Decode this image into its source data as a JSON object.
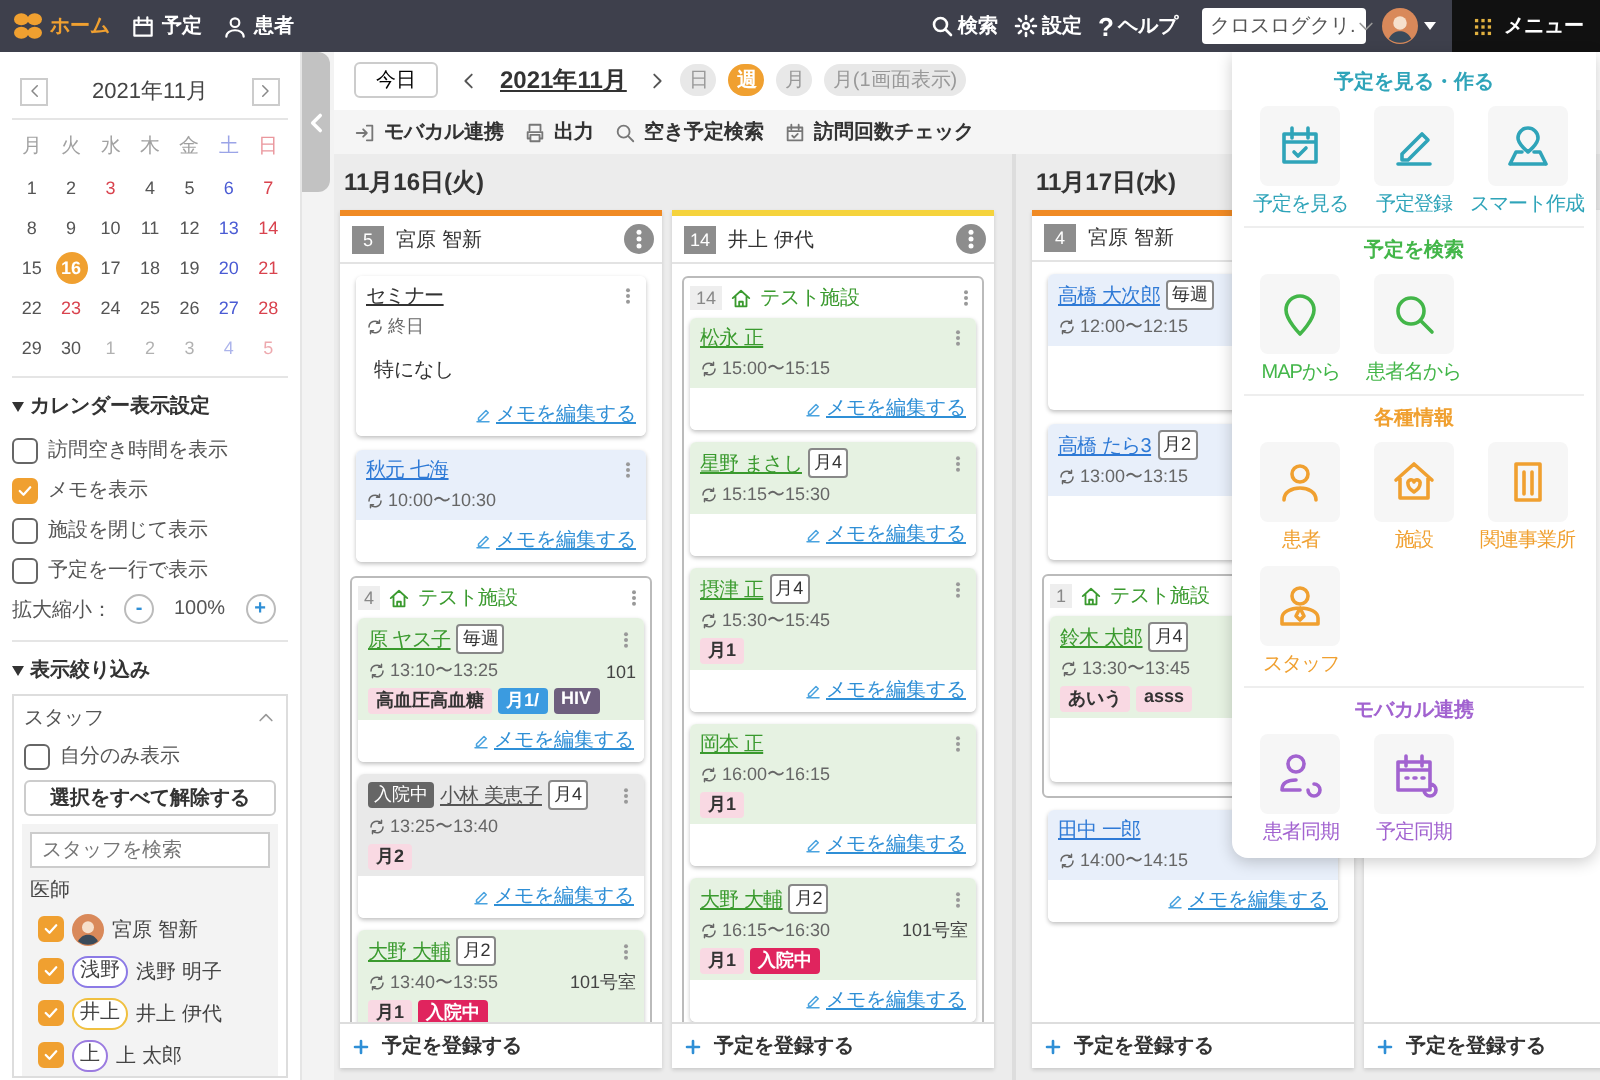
{
  "topbar": {
    "nav": [
      {
        "label": "ホーム",
        "kind": "logo",
        "selected": true
      },
      {
        "label": "予定",
        "kind": "calendar",
        "selected": false
      },
      {
        "label": "患者",
        "kind": "person",
        "selected": false
      }
    ],
    "tools": [
      {
        "label": "検索",
        "kind": "search"
      },
      {
        "label": "設定",
        "kind": "settings"
      },
      {
        "label": "ヘルプ",
        "kind": "help",
        "glyph": "?"
      }
    ],
    "clinic_select": "クロスログクリ.",
    "menu_label": "メニュー"
  },
  "calendar": {
    "title": "2021年11月",
    "weekdays": [
      {
        "label": "月",
        "kind": "normal"
      },
      {
        "label": "火",
        "kind": "normal"
      },
      {
        "label": "水",
        "kind": "normal"
      },
      {
        "label": "木",
        "kind": "normal"
      },
      {
        "label": "金",
        "kind": "normal"
      },
      {
        "label": "土",
        "kind": "saturday"
      },
      {
        "label": "日",
        "kind": "holiday"
      }
    ],
    "weeks": [
      [
        {
          "day": "1",
          "kind": "normal",
          "muted": false,
          "selected": false
        },
        {
          "day": "2",
          "kind": "normal",
          "muted": false,
          "selected": false
        },
        {
          "day": "3",
          "kind": "holiday",
          "muted": false,
          "selected": false
        },
        {
          "day": "4",
          "kind": "normal",
          "muted": false,
          "selected": false
        },
        {
          "day": "5",
          "kind": "normal",
          "muted": false,
          "selected": false
        },
        {
          "day": "6",
          "kind": "saturday",
          "muted": false,
          "selected": false
        },
        {
          "day": "7",
          "kind": "holiday",
          "muted": false,
          "selected": false
        }
      ],
      [
        {
          "day": "8",
          "kind": "normal",
          "muted": false,
          "selected": false
        },
        {
          "day": "9",
          "kind": "normal",
          "muted": false,
          "selected": false
        },
        {
          "day": "10",
          "kind": "normal",
          "muted": false,
          "selected": false
        },
        {
          "day": "11",
          "kind": "normal",
          "muted": false,
          "selected": false
        },
        {
          "day": "12",
          "kind": "normal",
          "muted": false,
          "selected": false
        },
        {
          "day": "13",
          "kind": "saturday",
          "muted": false,
          "selected": false
        },
        {
          "day": "14",
          "kind": "holiday",
          "muted": false,
          "selected": false
        }
      ],
      [
        {
          "day": "15",
          "kind": "normal",
          "muted": false,
          "selected": false
        },
        {
          "day": "16",
          "kind": "normal",
          "muted": false,
          "selected": true
        },
        {
          "day": "17",
          "kind": "normal",
          "muted": false,
          "selected": false
        },
        {
          "day": "18",
          "kind": "normal",
          "muted": false,
          "selected": false
        },
        {
          "day": "19",
          "kind": "normal",
          "muted": false,
          "selected": false
        },
        {
          "day": "20",
          "kind": "saturday",
          "muted": false,
          "selected": false
        },
        {
          "day": "21",
          "kind": "holiday",
          "muted": false,
          "selected": false
        }
      ],
      [
        {
          "day": "22",
          "kind": "normal",
          "muted": false,
          "selected": false
        },
        {
          "day": "23",
          "kind": "holiday",
          "muted": false,
          "selected": false
        },
        {
          "day": "24",
          "kind": "normal",
          "muted": false,
          "selected": false
        },
        {
          "day": "25",
          "kind": "normal",
          "muted": false,
          "selected": false
        },
        {
          "day": "26",
          "kind": "normal",
          "muted": false,
          "selected": false
        },
        {
          "day": "27",
          "kind": "saturday",
          "muted": false,
          "selected": false
        },
        {
          "day": "28",
          "kind": "holiday",
          "muted": false,
          "selected": false
        }
      ],
      [
        {
          "day": "29",
          "kind": "normal",
          "muted": false,
          "selected": false
        },
        {
          "day": "30",
          "kind": "normal",
          "muted": false,
          "selected": false
        },
        {
          "day": "1",
          "kind": "normal",
          "muted": true,
          "selected": false
        },
        {
          "day": "2",
          "kind": "normal",
          "muted": true,
          "selected": false
        },
        {
          "day": "3",
          "kind": "normal",
          "muted": true,
          "selected": false
        },
        {
          "day": "4",
          "kind": "saturday",
          "muted": true,
          "selected": false
        },
        {
          "day": "5",
          "kind": "holiday",
          "muted": true,
          "selected": false
        }
      ]
    ]
  },
  "display_settings": {
    "title": "カレンダー表示設定",
    "options": [
      {
        "label": "訪問空き時間を表示",
        "checked": false
      },
      {
        "label": "メモを表示",
        "checked": true
      },
      {
        "label": "施設を閉じて表示",
        "checked": false
      },
      {
        "label": "予定を一行で表示",
        "checked": false
      }
    ],
    "zoom_label": "拡大縮小：",
    "zoom_minus": "-",
    "zoom_value": "100%",
    "zoom_plus": "+"
  },
  "filter": {
    "title": "表示絞り込み",
    "panel_title": "スタッフ",
    "self_only": {
      "label": "自分のみ表示",
      "checked": false
    },
    "clear_button": "選択をすべて解除する",
    "search_placeholder": "スタッフを検索",
    "group": "医師",
    "staff": [
      {
        "name": "宮原 智新",
        "kind": "photo",
        "checked": true
      },
      {
        "name": "浅野 明子",
        "kind": "initials",
        "initials": "浅野",
        "color": "#8c7ae6",
        "checked": true
      },
      {
        "name": "井上 伊代",
        "kind": "initials",
        "initials": "井上",
        "color": "#f0c040",
        "checked": true
      },
      {
        "name": "上 太郎",
        "kind": "initials",
        "initials": "上",
        "color": "#9b7be0",
        "checked": true
      }
    ]
  },
  "toolbar": {
    "today": "今日",
    "month": "2021年11月",
    "views": [
      {
        "label": "日",
        "selected": false
      },
      {
        "label": "週",
        "selected": true
      },
      {
        "label": "月",
        "selected": false
      },
      {
        "label": "月(1画面表示)",
        "selected": false
      }
    ],
    "actions": [
      {
        "label": "モバカル連携",
        "kind": "sync-in"
      },
      {
        "label": "出力",
        "kind": "print"
      },
      {
        "label": "空き予定検索",
        "kind": "search"
      },
      {
        "label": "訪問回数チェック",
        "kind": "calendar-check"
      }
    ]
  },
  "days": [
    {
      "date": "11月16日(火)",
      "columns": [
        {
          "count": "5",
          "staff": "宮原 智新",
          "color": "#f08a24",
          "more_buttons": true,
          "add_label": "予定を登録する",
          "items": [
            {
              "kind": "event",
              "name": "セミナー",
              "time": "終日",
              "note": "特になし",
              "memo": "メモを編集する"
            },
            {
              "kind": "home",
              "name": "秋元 七海",
              "time": "10:00〜10:30",
              "memo": "メモを編集する"
            },
            {
              "kind": "group",
              "count": "4",
              "facility": "テスト施設",
              "cards": [
                {
                  "kind": "facility",
                  "name": "原 ヤス子",
                  "frequency": "毎週",
                  "time": "13:10〜13:25",
                  "room": "101",
                  "tags": [
                    {
                      "label": "高血圧高血糖",
                      "color": "#f9d9e3"
                    },
                    {
                      "label": "月1/",
                      "color": "#3b9be0"
                    },
                    {
                      "label": "HIV",
                      "color": "#6e5f7e"
                    }
                  ],
                  "memo": "メモを編集する"
                },
                {
                  "kind": "inpatient",
                  "status": "入院中",
                  "name": "小林 美恵子",
                  "frequency": "月4",
                  "time": "13:25〜13:40",
                  "tags": [
                    {
                      "label": "月2",
                      "color": "#f9d9e3"
                    }
                  ],
                  "memo": "メモを編集する"
                },
                {
                  "kind": "facility",
                  "name": "大野 大輔",
                  "frequency": "月2",
                  "time": "13:40〜13:55",
                  "room": "101号室",
                  "tags": [
                    {
                      "label": "月1",
                      "color": "#f9d9e3"
                    },
                    {
                      "label": "入院中",
                      "color": "#e0245e"
                    }
                  ]
                }
              ]
            }
          ]
        },
        {
          "count": "14",
          "staff": "井上 伊代",
          "color": "#f5d33c",
          "more_buttons": true,
          "add_label": "予定を登録する",
          "items": [
            {
              "kind": "group",
              "count": "14",
              "facility": "テスト施設",
              "cards": [
                {
                  "kind": "facility",
                  "name": "松永 正",
                  "time": "15:00〜15:15",
                  "memo": "メモを編集する"
                },
                {
                  "kind": "facility",
                  "name": "星野 まさし",
                  "frequency": "月4",
                  "time": "15:15〜15:30",
                  "memo": "メモを編集する"
                },
                {
                  "kind": "facility",
                  "name": "摂津 正",
                  "frequency": "月4",
                  "time": "15:30〜15:45",
                  "tags": [
                    {
                      "label": "月1",
                      "color": "#f9d9e3"
                    }
                  ],
                  "memo": "メモを編集する"
                },
                {
                  "kind": "facility",
                  "name": "岡本 正",
                  "time": "16:00〜16:15",
                  "tags": [
                    {
                      "label": "月1",
                      "color": "#f9d9e3"
                    }
                  ],
                  "memo": "メモを編集する"
                },
                {
                  "kind": "facility",
                  "name": "大野 大輔",
                  "frequency": "月2",
                  "time": "16:15〜16:30",
                  "room": "101号室",
                  "tags": [
                    {
                      "label": "月1",
                      "color": "#f9d9e3"
                    },
                    {
                      "label": "入院中",
                      "color": "#e0245e"
                    }
                  ],
                  "memo": "メモを編集する"
                }
              ]
            }
          ]
        }
      ]
    },
    {
      "date": "11月17日(水)",
      "columns": [
        {
          "count": "4",
          "staff": "宮原 智新",
          "color": "#f08a24",
          "more_buttons": false,
          "add_label": "予定を登録する",
          "items": [
            {
              "kind": "home",
              "name": "高橋 大次郎",
              "frequency": "毎週",
              "time": "12:00〜12:15",
              "memo_area": true
            },
            {
              "kind": "home",
              "name": "高橋 たら3",
              "frequency": "月2",
              "time": "13:00〜13:15",
              "memo_area": true
            },
            {
              "kind": "group",
              "count": "1",
              "facility": "テスト施設",
              "cards": [
                {
                  "kind": "facility",
                  "name": "鈴木 太郎",
                  "frequency": "月4",
                  "time": "13:30〜13:45",
                  "tags": [
                    {
                      "label": "あいう",
                      "color": "#f9d9e3"
                    },
                    {
                      "label": "asss",
                      "color": "#f9d9e3"
                    }
                  ],
                  "memo_area": true
                }
              ]
            },
            {
              "kind": "home",
              "name": "田中 一郎",
              "time": "14:00〜14:15",
              "memo": "メモを編集する"
            }
          ]
        },
        {
          "add_label": "予定を登録する"
        }
      ]
    }
  ],
  "menu": {
    "sections": [
      {
        "title": "予定を見る・作る",
        "color": "#2fa4b9",
        "items": [
          {
            "label": "予定を見る",
            "kind": "calendar-check"
          },
          {
            "label": "予定登録",
            "kind": "pencil"
          },
          {
            "label": "スマート作成",
            "kind": "map-pin"
          }
        ]
      },
      {
        "title": "予定を検索",
        "color": "#43b649",
        "items": [
          {
            "label": "MAPから",
            "kind": "marker"
          },
          {
            "label": "患者名から",
            "kind": "search"
          }
        ]
      },
      {
        "title": "各種情報",
        "color": "#f0a030",
        "items": [
          {
            "label": "患者",
            "kind": "person"
          },
          {
            "label": "施設",
            "kind": "house"
          },
          {
            "label": "関連事業所",
            "kind": "building"
          },
          {
            "label": "スタッフ",
            "kind": "staff"
          }
        ]
      },
      {
        "title": "モバカル連携",
        "color": "#a263d0",
        "items": [
          {
            "label": "患者同期",
            "kind": "person-sync"
          },
          {
            "label": "予定同期",
            "kind": "calendar-sync"
          }
        ]
      }
    ]
  }
}
